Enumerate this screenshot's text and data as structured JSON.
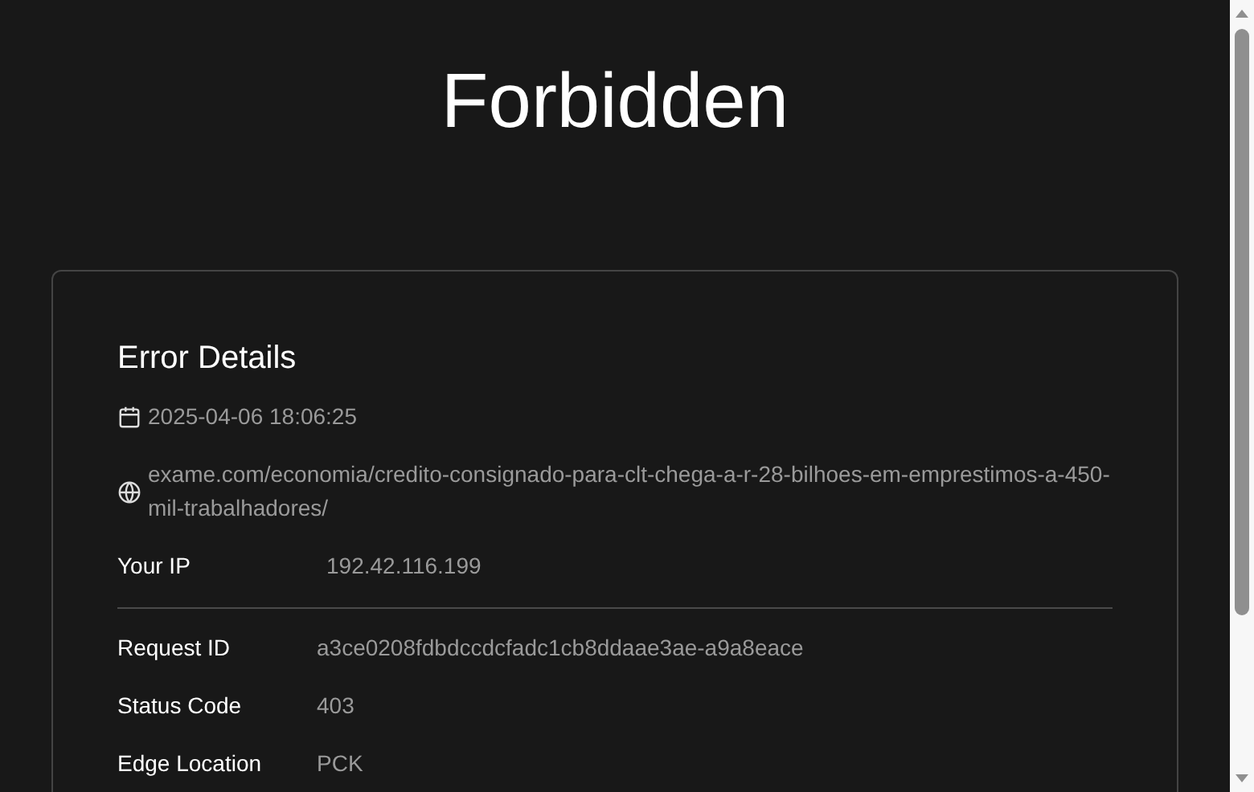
{
  "title": "Forbidden",
  "card": {
    "heading": "Error Details",
    "timestamp": "2025-04-06 18:06:25",
    "url": "exame.com/economia/credito-consignado-para-clt-chega-a-r-28-bilhoes-em-emprestimos-a-450-mil-trabalhadores/",
    "your_ip": {
      "label": "Your IP",
      "value": "192.42.116.199"
    },
    "details": [
      {
        "label": "Request ID",
        "value": "a3ce0208fdbdccdcfadc1cb8ddaae3ae-a9a8eace"
      },
      {
        "label": "Status Code",
        "value": "403"
      },
      {
        "label": "Edge Location",
        "value": "PCK"
      }
    ]
  }
}
